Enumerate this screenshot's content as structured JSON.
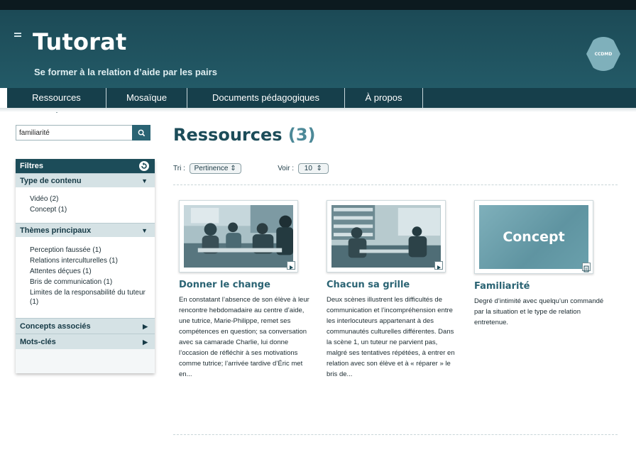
{
  "header": {
    "title": "Tutorat",
    "subtitle": "Se former à la relation d’aide par les pairs",
    "logo_text": "CCDMD"
  },
  "nav": {
    "tabs": [
      {
        "label": "Ressources"
      },
      {
        "label": "Mosaïque"
      },
      {
        "label": "Documents pédagogiques"
      },
      {
        "label": "À propos"
      }
    ]
  },
  "search": {
    "value": "familiarité"
  },
  "filters": {
    "title": "Filtres",
    "sections": [
      {
        "label": "Type de contenu",
        "items": [
          "Vidéo (2)",
          "Concept (1)"
        ]
      },
      {
        "label": "Thèmes principaux",
        "items": [
          "Perception faussée (1)",
          "Relations interculturelles (1)",
          "Attentes déçues (1)",
          "Bris de communication (1)",
          "Limites de la responsabilité du tuteur (1)"
        ]
      },
      {
        "label": "Concepts associés",
        "items": []
      },
      {
        "label": "Mots-clés",
        "items": []
      }
    ]
  },
  "main": {
    "title": "Ressources",
    "count": "(3)",
    "sort_label": "Tri :",
    "sort_value": "Pertinence",
    "view_label": "Voir :",
    "view_value": "10"
  },
  "cards": [
    {
      "title": "Donner le change",
      "text": "En constatant l’absence de son élève à leur rencontre hebdomadaire au centre d’aide, une tutrice, Marie-Philippe, remet ses compétences en question; sa conversation avec sa camarade Charlie, lui donne l’occasion de réfléchir à ses motivations comme tutrice; l’arrivée tardive d’Éric met en..."
    },
    {
      "title": "Chacun sa grille",
      "text": "Deux scènes illustrent les difficultés de communication et l’incompréhension entre les interlocuteurs appartenant à des communautés culturelles différentes. Dans la scène 1, un tuteur ne parvient pas, malgré ses tentatives répétées, à entrer en relation avec son élève et à « réparer » le bris de..."
    },
    {
      "title": "Familiarité",
      "thumb_label": "Concept",
      "text": "Degré d’intimité avec quelqu’un commandé par la situation et le type de relation entretenue."
    }
  ]
}
